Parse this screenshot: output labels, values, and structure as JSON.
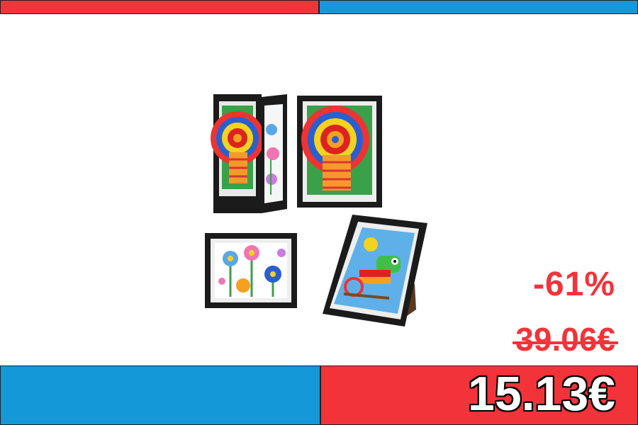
{
  "colors": {
    "red": "#f2333a",
    "blue": "#1598d8",
    "frame": "#1b1b1b"
  },
  "product": {
    "image": "four-black-art-frames-with-childrens-drawings"
  },
  "discount": "-61%",
  "old_price": "39.06€",
  "new_price": "15.13€"
}
